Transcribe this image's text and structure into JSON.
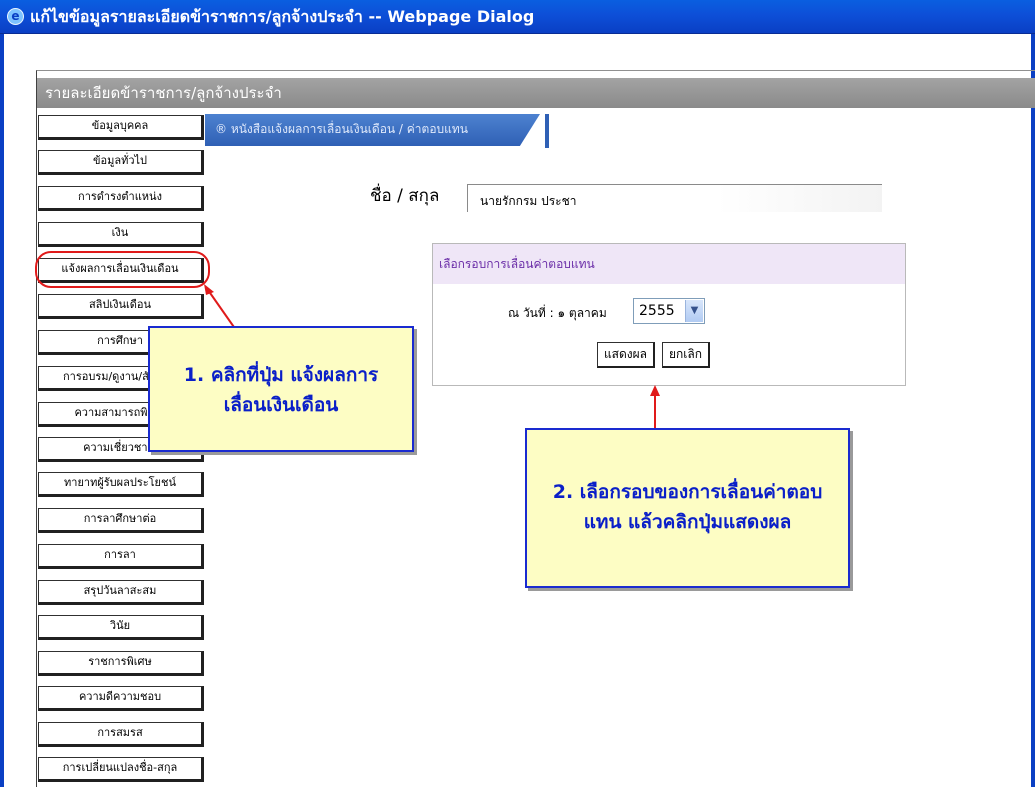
{
  "window": {
    "title": "แก้ไขข้อมูลรายละเอียดข้าราชการ/ลูกจ้างประจำ -- Webpage Dialog"
  },
  "header": {
    "title": "รายละเอียดข้าราชการ/ลูกจ้างประจำ"
  },
  "sidebar": {
    "items": [
      {
        "label": "ข้อมูลบุคคล"
      },
      {
        "label": "ข้อมูลทั่วไป"
      },
      {
        "label": "การดำรงตำแหน่ง"
      },
      {
        "label": "เงิน"
      },
      {
        "label": "แจ้งผลการเลื่อนเงินเดือน"
      },
      {
        "label": "สลิปเงินเดือน"
      },
      {
        "label": "การศึกษา"
      },
      {
        "label": "การอบรม/ดูงาน/สัมมนา"
      },
      {
        "label": "ความสามารถพิเศษ"
      },
      {
        "label": "ความเชี่ยวชาญ"
      },
      {
        "label": "ทายาทผู้รับผลประโยชน์"
      },
      {
        "label": "การลาศึกษาต่อ"
      },
      {
        "label": "การลา"
      },
      {
        "label": "สรุปวันลาสะสม"
      },
      {
        "label": "วินัย"
      },
      {
        "label": "ราชการพิเศษ"
      },
      {
        "label": "ความดีความชอบ"
      },
      {
        "label": "การสมรส"
      },
      {
        "label": "การเปลี่ยนแปลงชื่อ-สกุล"
      }
    ]
  },
  "tab": {
    "label": "® หนังสือแจ้งผลการเลื่อนเงินเดือน / ค่าตอบแทน"
  },
  "name_field": {
    "label": "ชื่อ / สกุล",
    "value": "นายรักกรม ประชา"
  },
  "round_panel": {
    "heading": "เลือกรอบการเลื่อนค่าตอบแทน",
    "date_label": "ณ วันที่ : ๑ ตุลาคม",
    "year": "2555",
    "show_button": "แสดงผล",
    "cancel_button": "ยกเลิก"
  },
  "callouts": {
    "step1_line1": "1. คลิกที่ปุ่ม แจ้งผลการ",
    "step1_line2": "เลื่อนเงินเดือน",
    "step2_line1": "2. เลือกรอบของการเลื่อนค่าตอบ",
    "step2_line2": "แทน แล้วคลิกปุ่มแสดงผล"
  },
  "colors": {
    "titlebar": "#0d4fd8",
    "callout_bg": "#fdfdc4",
    "callout_text": "#0a1fc8",
    "highlight": "#e01a1a",
    "tab": "#3a6cbf"
  }
}
